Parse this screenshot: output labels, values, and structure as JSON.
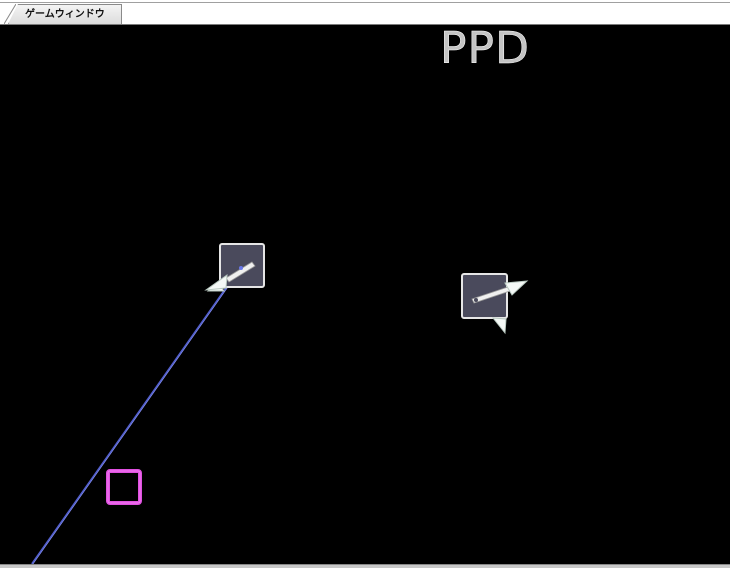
{
  "window": {
    "tab_label": "ゲームウィンドウ"
  },
  "game": {
    "mode_text": "PPD",
    "colors": {
      "background": "#000000",
      "block_fill": "#4a4a5c",
      "block_border": "#e8e8e8",
      "beam": "#6a78e8",
      "player_box": "#e050e0"
    },
    "objects": [
      {
        "name": "arrow-block-left",
        "icon": "arrow-down-left-icon"
      },
      {
        "name": "arrow-block-right",
        "icon": "arrow-up-right-icon"
      },
      {
        "name": "player-square",
        "icon": "square-icon"
      }
    ]
  }
}
